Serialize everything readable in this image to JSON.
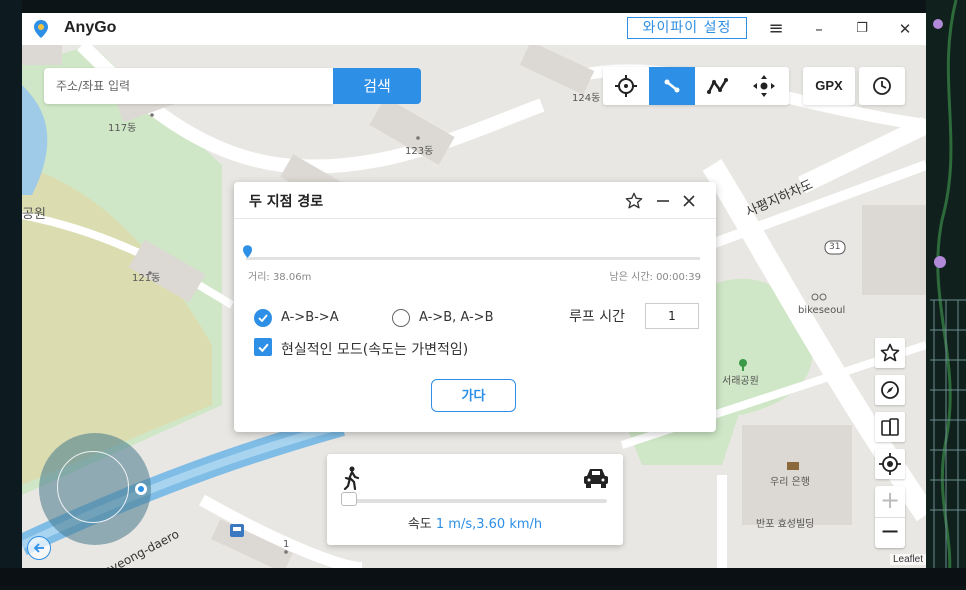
{
  "window": {
    "app_title": "AnyGo",
    "wifi_settings_label": "와이파이 설정",
    "menu_glyph": "≡",
    "minimize_glyph": "–",
    "restore_glyph": "❐",
    "close_glyph": "✕"
  },
  "search": {
    "placeholder": "주소/좌표 입력",
    "button_label": "검색"
  },
  "toolbar": {
    "gpx_label": "GPX",
    "active_mode": "two-spot-route"
  },
  "map_labels": {
    "building_117": "117동",
    "building_124": "124동",
    "building_123": "123동",
    "building_121": "121동",
    "building_1": "1",
    "park_left": "공원",
    "underpass": "사평지하차도",
    "route_31": "31",
    "bikeseoul": "bikeseoul",
    "seorae_park": "서래공원",
    "woori_bank": "우리 은행",
    "banpo_building": "반포 효성빌딩",
    "sapyeong_daero": "Sapyeong-daero",
    "leaflet": "Leaflet"
  },
  "dialog": {
    "title": "두 지점 경로",
    "progress_fraction": 0.0,
    "distance_text": "거리: 38.06m",
    "remaining_text": "남은 시간: 00:00:39",
    "option_aba": "A->B->A",
    "option_ab": "A->B, A->B",
    "option_aba_selected": true,
    "loop_label": "루프 시간",
    "loop_value": "1",
    "realistic_mode_label": "현실적인 모드(속도는 가변적임)",
    "realistic_mode_checked": true,
    "go_label": "가다"
  },
  "speed": {
    "label": "속도",
    "value_text": "1 m/s,3.60 km/h",
    "slider_fraction": 0.0
  },
  "colors": {
    "accent": "#2d8fe6",
    "map_bg": "#e9e7e3",
    "park": "#c8e6c0",
    "water": "#84c2ea"
  }
}
